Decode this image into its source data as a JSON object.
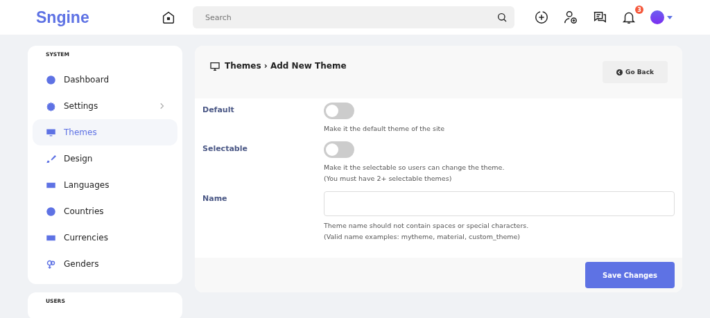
{
  "header": {
    "logo": "Sngine",
    "search": {
      "placeholder": "Search"
    },
    "notifications_badge": "3"
  },
  "sidebar": [
    {
      "title": "SYSTEM",
      "items": [
        {
          "label": "Dashboard",
          "selected": false,
          "has_submenu": false
        },
        {
          "label": "Settings",
          "selected": false,
          "has_submenu": true
        },
        {
          "label": "Themes",
          "selected": true,
          "has_submenu": false
        },
        {
          "label": "Design",
          "selected": false,
          "has_submenu": false
        },
        {
          "label": "Languages",
          "selected": false,
          "has_submenu": false
        },
        {
          "label": "Countries",
          "selected": false,
          "has_submenu": false
        },
        {
          "label": "Currencies",
          "selected": false,
          "has_submenu": false
        },
        {
          "label": "Genders",
          "selected": false,
          "has_submenu": false
        }
      ]
    },
    {
      "title": "USERS"
    }
  ],
  "panel": {
    "title": "Themes › Add New Theme",
    "back_button": "Go Back",
    "fields": [
      {
        "kind": "toggle",
        "label": "Default",
        "on": false,
        "help": [
          "Make it the default theme of the site"
        ]
      },
      {
        "kind": "toggle",
        "label": "Selectable",
        "on": false,
        "help": [
          "Make it the selectable so users can change the theme.",
          "(You must have 2+ selectable themes)"
        ]
      },
      {
        "kind": "text",
        "label": "Name",
        "help": [
          "Theme name should not contain spaces or special characters.",
          "(Valid name examples: mytheme, material, custom_theme)"
        ]
      }
    ],
    "save_button": "Save Changes"
  }
}
